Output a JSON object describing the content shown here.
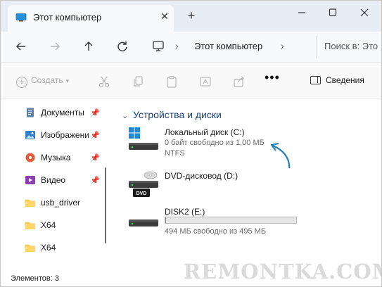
{
  "window": {
    "tab_title": "Этот компьютер",
    "new_tab_label": "+",
    "close_tab_label": "✕"
  },
  "navigation": {
    "breadcrumb": "Этот компьютер",
    "search_placeholder": "Поиск в: Это"
  },
  "commandbar": {
    "create_label": "Создать",
    "more_label": "•••",
    "details_label": "Сведения"
  },
  "sidebar": {
    "items": [
      {
        "label": "Документы",
        "icon": "documents-icon",
        "pinned": true
      },
      {
        "label": "Изображени",
        "icon": "pictures-icon",
        "pinned": true
      },
      {
        "label": "Музыка",
        "icon": "music-icon",
        "pinned": true
      },
      {
        "label": "Видео",
        "icon": "video-icon",
        "pinned": true
      },
      {
        "label": "usb_driver",
        "icon": "folder-icon",
        "pinned": false
      },
      {
        "label": "X64",
        "icon": "folder-icon",
        "pinned": false
      },
      {
        "label": "X64",
        "icon": "folder-icon",
        "pinned": false
      }
    ]
  },
  "main": {
    "group_title": "Устройства и диски",
    "drives": [
      {
        "name": "Локальный диск (C:)",
        "free": "0 байт свободно из 1,00 МБ",
        "fs": "NTFS",
        "icon": "windows-drive-icon"
      },
      {
        "name": "DVD-дисковод (D:)",
        "icon": "dvd-drive-icon",
        "dvd_label": "DVD"
      },
      {
        "name": "DISK2 (E:)",
        "free": "494 МБ свободно из 495 МБ",
        "icon": "drive-icon",
        "used_fraction": 0.002
      }
    ]
  },
  "status": {
    "items_count": "Элементов: 3"
  },
  "watermark": "REMONTKA.COM",
  "colors": {
    "accent": "#26a0da",
    "arrow": "#1f7fbf",
    "group_title": "#1c3d73"
  }
}
